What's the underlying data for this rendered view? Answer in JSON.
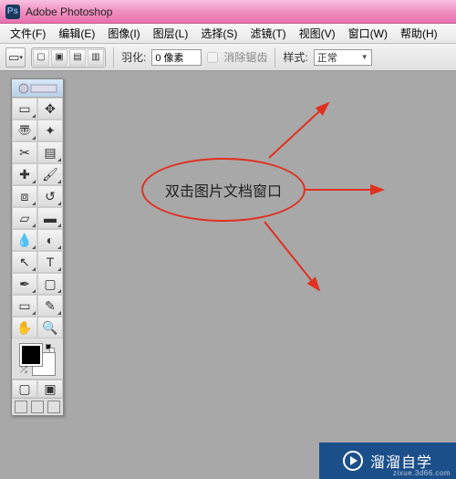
{
  "titlebar": {
    "app_name": "Adobe Photoshop"
  },
  "menubar": {
    "items": [
      "文件(F)",
      "编辑(E)",
      "图像(I)",
      "图层(L)",
      "选择(S)",
      "滤镜(T)",
      "视图(V)",
      "窗口(W)",
      "帮助(H)"
    ]
  },
  "optionsbar": {
    "feather_label": "羽化:",
    "feather_value": "0 像素",
    "antialias_label": "消除锯齿",
    "style_label": "样式:",
    "style_value": "正常"
  },
  "toolbox": {
    "tools": [
      {
        "name": "rect-marquee-tool",
        "glyph": "▭",
        "flyout": true
      },
      {
        "name": "move-tool",
        "glyph": "✥",
        "flyout": false
      },
      {
        "name": "lasso-tool",
        "glyph": "〠",
        "flyout": true
      },
      {
        "name": "magic-wand-tool",
        "glyph": "✦",
        "flyout": false
      },
      {
        "name": "crop-tool",
        "glyph": "✂",
        "flyout": false
      },
      {
        "name": "slice-tool",
        "glyph": "▤",
        "flyout": true
      },
      {
        "name": "healing-brush-tool",
        "glyph": "✚",
        "flyout": true
      },
      {
        "name": "brush-tool",
        "glyph": "🖌",
        "flyout": true
      },
      {
        "name": "clone-stamp-tool",
        "glyph": "⧈",
        "flyout": true
      },
      {
        "name": "history-brush-tool",
        "glyph": "↺",
        "flyout": true
      },
      {
        "name": "eraser-tool",
        "glyph": "▱",
        "flyout": true
      },
      {
        "name": "gradient-tool",
        "glyph": "▬",
        "flyout": true
      },
      {
        "name": "blur-tool",
        "glyph": "💧",
        "flyout": true
      },
      {
        "name": "dodge-tool",
        "glyph": "◐",
        "flyout": true
      },
      {
        "name": "path-select-tool",
        "glyph": "↖",
        "flyout": true
      },
      {
        "name": "type-tool",
        "glyph": "T",
        "flyout": true
      },
      {
        "name": "pen-tool",
        "glyph": "✒",
        "flyout": true
      },
      {
        "name": "rectangle-shape-tool",
        "glyph": "▢",
        "flyout": true
      },
      {
        "name": "notes-tool",
        "glyph": "▭",
        "flyout": true
      },
      {
        "name": "eyedropper-tool",
        "glyph": "✎",
        "flyout": true
      },
      {
        "name": "hand-tool",
        "glyph": "✋",
        "flyout": false
      },
      {
        "name": "zoom-tool",
        "glyph": "🔍",
        "flyout": false
      }
    ],
    "swatch": {
      "fg": "#000000",
      "bg": "#ffffff"
    },
    "footer_icons": [
      {
        "name": "quickmask-off",
        "glyph": "▢"
      },
      {
        "name": "quickmask-on",
        "glyph": "▣"
      }
    ]
  },
  "annotations": {
    "ellipse_text": "双击图片文档窗口",
    "arrow_color": "#e03020"
  },
  "watermark": {
    "brand": "溜溜自学",
    "url": "zixue.3d66.com"
  }
}
